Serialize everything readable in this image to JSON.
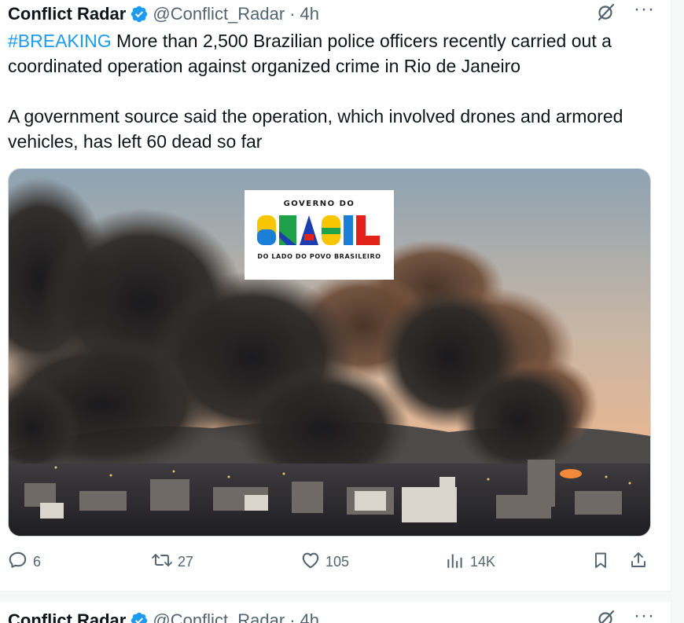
{
  "tweet": {
    "author_name": "Conflict Radar",
    "handle": "@Conflict_Radar",
    "separator": "·",
    "time": "4h",
    "hashtag": "#BREAKING",
    "text_line1_rest": " More than 2,500 Brazilian police officers recently carried out a coordinated operation against organized crime in Rio de Janeiro",
    "text_para2": "A government source said the operation, which involved drones and armored vehicles, has left 60 dead so far",
    "media": {
      "logo_top": "GOVERNO DO",
      "logo_word": "BRASIL",
      "logo_bottom": "DO LADO DO POVO BRASILEIRO"
    },
    "actions": {
      "replies": "6",
      "reposts": "27",
      "likes": "105",
      "views": "14K"
    }
  },
  "next_tweet": {
    "author_name": "Conflict Radar",
    "handle": "@Conflict_Radar",
    "separator": "·",
    "time": "4h"
  },
  "colors": {
    "accent": "#1d9bf0",
    "muted": "#536471",
    "text": "#0f1419"
  },
  "icons": [
    "verified-badge-icon",
    "grok-slash-icon",
    "more-icon",
    "reply-icon",
    "repost-icon",
    "like-icon",
    "views-icon",
    "bookmark-icon",
    "share-icon"
  ]
}
